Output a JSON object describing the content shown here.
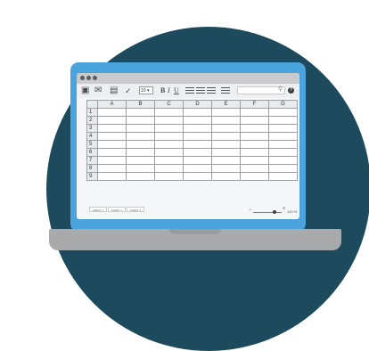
{
  "colors": {
    "backdrop": "#1d4a5c",
    "laptop_bezel": "#4aa3dc",
    "laptop_base": "#a9aaac"
  },
  "toolbar": {
    "icons": [
      "save-icon",
      "mail-icon",
      "print-icon",
      "check-icon",
      "search-icon",
      "help-icon"
    ],
    "font_size": "10 ▾",
    "bold": "B",
    "italic": "I",
    "underline": "U",
    "search_placeholder": "",
    "help": "?"
  },
  "sheet": {
    "columns": [
      "A",
      "B",
      "C",
      "D",
      "E",
      "F",
      "G"
    ],
    "rows": [
      "1",
      "2",
      "3",
      "4",
      "5",
      "6",
      "7",
      "8",
      "9"
    ]
  },
  "sheet_tabs": [
    "SHEET 1",
    "SHEET 2",
    "SHEET 3"
  ],
  "zoom": {
    "minus": "−",
    "plus": "+",
    "level": "100 %",
    "level_fraction": 0.75
  }
}
